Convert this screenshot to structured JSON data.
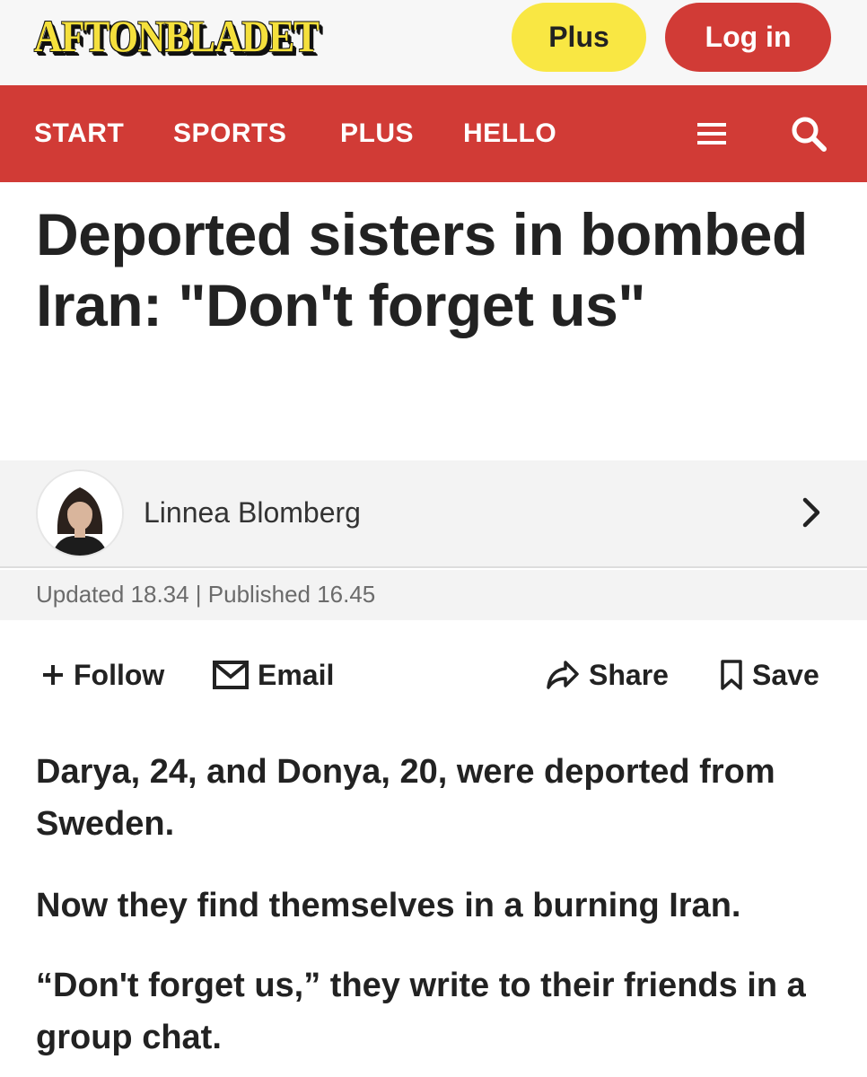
{
  "header": {
    "logo": "AFTONBLADET",
    "plus_label": "Plus",
    "login_label": "Log in"
  },
  "nav": {
    "items": [
      "START",
      "SPORTS",
      "PLUS",
      "HELLO"
    ],
    "menu_icon": "hamburger-menu-icon",
    "search_icon": "search-icon"
  },
  "article": {
    "headline": "Deported sisters in bombed Iran: \"Don't forget us\"",
    "author": "Linnea Blomberg",
    "meta": "Updated 18.34 | Published 16.45",
    "actions": {
      "follow": "Follow",
      "email": "Email",
      "share": "Share",
      "save": "Save"
    },
    "paragraphs": [
      "Darya, 24, and Donya, 20, were deported from Sweden.",
      "Now they find themselves in a burning Iran.",
      "“Don't forget us,” they write to their friends in a group chat."
    ]
  },
  "colors": {
    "brand_red": "#d13b36",
    "brand_yellow": "#f9e743",
    "text": "#222222"
  }
}
